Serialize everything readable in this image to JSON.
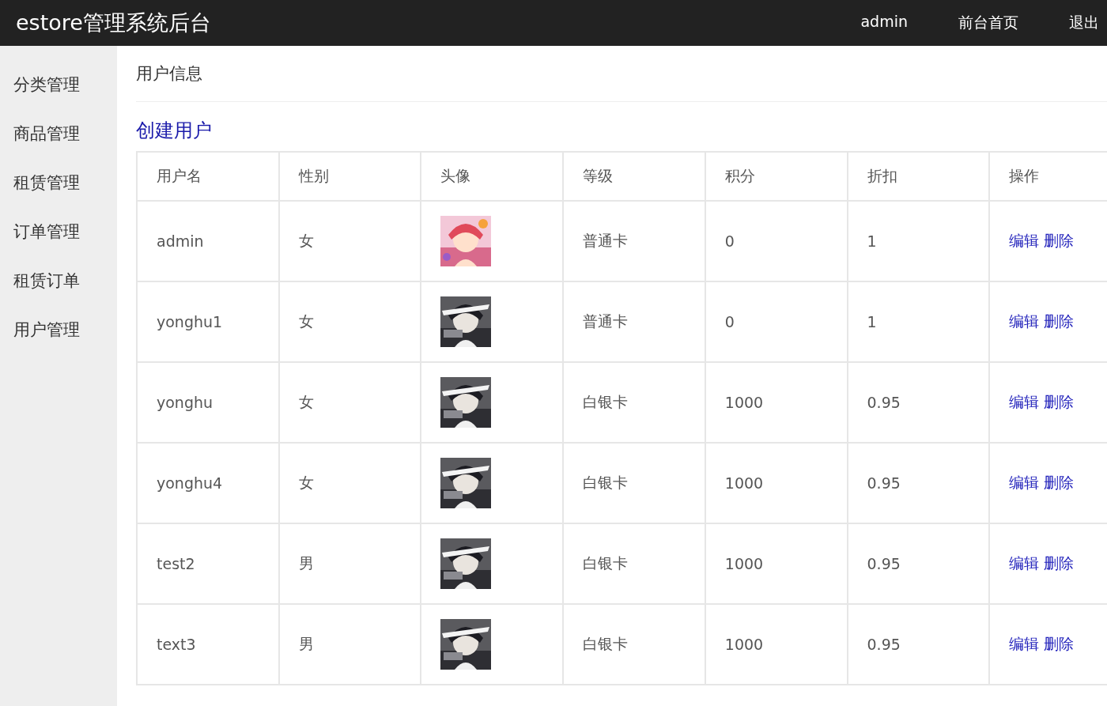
{
  "header": {
    "title": "estore管理系统后台",
    "nav": [
      "admin",
      "前台首页",
      "退出"
    ]
  },
  "sidebar": {
    "items": [
      "分类管理",
      "商品管理",
      "租赁管理",
      "订单管理",
      "租赁订单",
      "用户管理"
    ]
  },
  "page": {
    "title": "用户信息",
    "create_link": "创建用户"
  },
  "table": {
    "columns": [
      "用户名",
      "性别",
      "头像",
      "等级",
      "积分",
      "折扣",
      "操作"
    ],
    "rows": [
      {
        "username": "admin",
        "gender": "女",
        "avatar": {
          "kind": "picture"
        },
        "level": "普通卡",
        "points": "0",
        "discount": "1",
        "actions": [
          "编辑",
          "删除"
        ]
      },
      {
        "username": "yonghu1",
        "gender": "女",
        "avatar": {
          "kind": "picture"
        },
        "level": "普通卡",
        "points": "0",
        "discount": "1",
        "actions": [
          "编辑",
          "删除"
        ]
      },
      {
        "username": "yonghu",
        "gender": "女",
        "avatar": {
          "kind": "picture"
        },
        "level": "白银卡",
        "points": "1000",
        "discount": "0.95",
        "actions": [
          "编辑",
          "删除"
        ]
      },
      {
        "username": "yonghu4",
        "gender": "女",
        "avatar": {
          "kind": "picture"
        },
        "level": "白银卡",
        "points": "1000",
        "discount": "0.95",
        "actions": [
          "编辑",
          "删除"
        ]
      },
      {
        "username": "test2",
        "gender": "男",
        "avatar": {
          "kind": "picture"
        },
        "level": "白银卡",
        "points": "1000",
        "discount": "0.95",
        "actions": [
          "编辑",
          "删除"
        ]
      },
      {
        "username": "text3",
        "gender": "男",
        "avatar": {
          "kind": "picture"
        },
        "level": "白银卡",
        "points": "1000",
        "discount": "0.95",
        "actions": [
          "编辑",
          "删除"
        ]
      }
    ]
  }
}
